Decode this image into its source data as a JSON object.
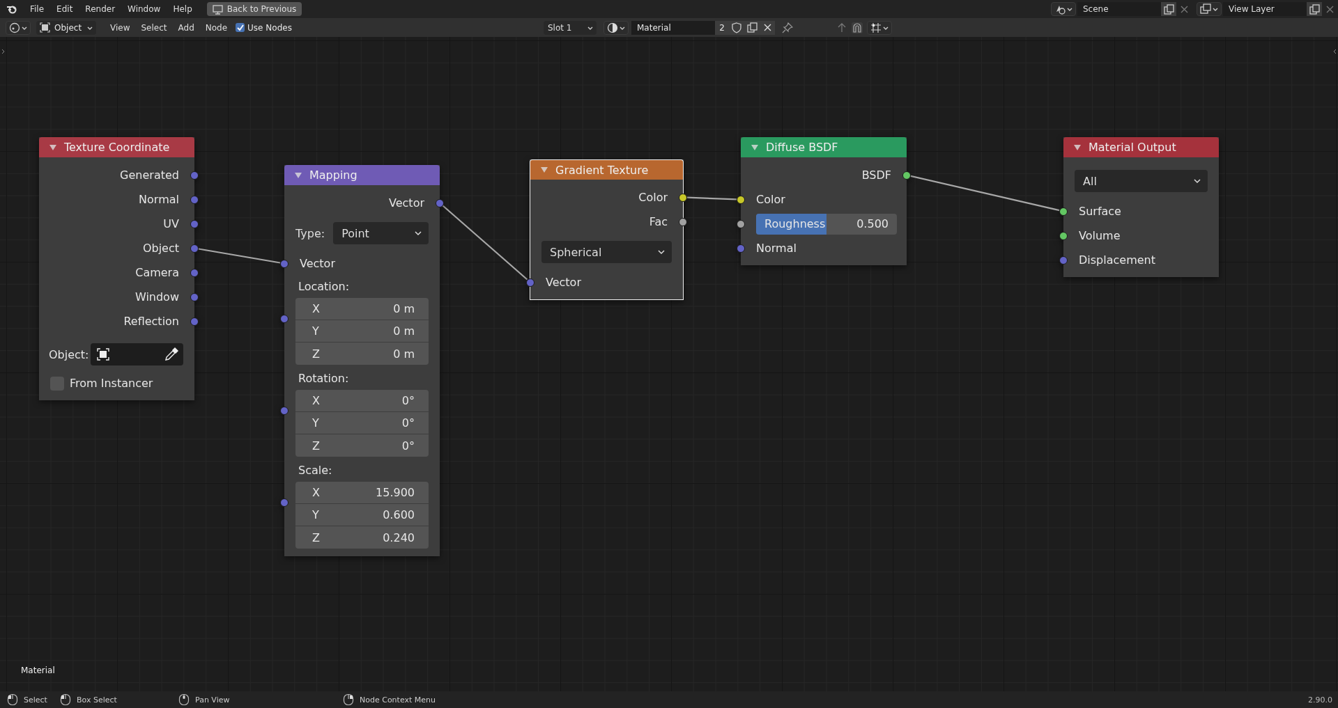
{
  "topbar": {
    "menus": [
      "File",
      "Edit",
      "Render",
      "Window",
      "Help"
    ],
    "back_button": "Back to Previous",
    "scene": {
      "value": "Scene"
    },
    "view_layer": {
      "value": "View Layer"
    }
  },
  "header": {
    "mode": "Object",
    "menus": [
      "View",
      "Select",
      "Add",
      "Node"
    ],
    "use_nodes": {
      "label": "Use Nodes",
      "checked": true
    },
    "slot": "Slot 1",
    "material": {
      "value": "Material",
      "users": "2"
    }
  },
  "nodes": [
    {
      "title": "Texture Coordinate",
      "color": "#a83a45",
      "selected": false,
      "items": [
        {
          "kind": "output",
          "label": "Generated",
          "color": "#6363c7"
        },
        {
          "kind": "output",
          "label": "Normal",
          "color": "#6363c7"
        },
        {
          "kind": "output",
          "label": "UV",
          "color": "#6363c7"
        },
        {
          "kind": "output",
          "label": "Object",
          "color": "#6363c7",
          "linked": true
        },
        {
          "kind": "output",
          "label": "Camera",
          "color": "#6363c7"
        },
        {
          "kind": "output",
          "label": "Window",
          "color": "#6363c7"
        },
        {
          "kind": "output",
          "label": "Reflection",
          "color": "#6363c7"
        },
        {
          "kind": "object",
          "label": "Object:"
        },
        {
          "kind": "checkbox",
          "label": "From Instancer",
          "checked": false
        }
      ]
    },
    {
      "title": "Mapping",
      "color": "#6f5bb5",
      "selected": false,
      "items": [
        {
          "kind": "output",
          "label": "Vector",
          "color": "#6363c7",
          "linked": true
        },
        {
          "kind": "menu",
          "label": "Type:",
          "value": "Point"
        },
        {
          "kind": "input",
          "label": "Vector",
          "color": "#6363c7",
          "linked": true
        },
        {
          "kind": "vector",
          "label": "Location:",
          "color": "#6363c7",
          "fields": [
            {
              "axis": "X",
              "value": "0 m"
            },
            {
              "axis": "Y",
              "value": "0 m"
            },
            {
              "axis": "Z",
              "value": "0 m"
            }
          ]
        },
        {
          "kind": "vector",
          "label": "Rotation:",
          "color": "#6363c7",
          "fields": [
            {
              "axis": "X",
              "value": "0°"
            },
            {
              "axis": "Y",
              "value": "0°"
            },
            {
              "axis": "Z",
              "value": "0°"
            }
          ]
        },
        {
          "kind": "vector",
          "label": "Scale:",
          "color": "#6363c7",
          "fields": [
            {
              "axis": "X",
              "value": "15.900"
            },
            {
              "axis": "Y",
              "value": "0.600"
            },
            {
              "axis": "Z",
              "value": "0.240"
            }
          ]
        }
      ]
    },
    {
      "title": "Gradient Texture",
      "color": "#b8672f",
      "selected": true,
      "items": [
        {
          "kind": "output",
          "label": "Color",
          "color": "#c7c729",
          "linked": true
        },
        {
          "kind": "output",
          "label": "Fac",
          "color": "#a1a1a1"
        },
        {
          "kind": "menu",
          "value": "Spherical"
        },
        {
          "kind": "input",
          "label": "Vector",
          "color": "#6363c7",
          "linked": true
        }
      ]
    },
    {
      "title": "Diffuse BSDF",
      "color": "#2a9a5f",
      "selected": false,
      "items": [
        {
          "kind": "output",
          "label": "BSDF",
          "color": "#63c763",
          "linked": true
        },
        {
          "kind": "input",
          "label": "Color",
          "color": "#c7c729",
          "linked": true
        },
        {
          "kind": "slider",
          "label": "Roughness",
          "value": "0.500",
          "level": 0.5,
          "color": "#a1a1a1"
        },
        {
          "kind": "input",
          "label": "Normal",
          "color": "#6363c7"
        }
      ]
    },
    {
      "title": "Material Output",
      "color": "#a5323c",
      "selected": false,
      "items": [
        {
          "kind": "menu",
          "value": "All"
        },
        {
          "kind": "input",
          "label": "Surface",
          "color": "#63c763",
          "linked": true
        },
        {
          "kind": "input",
          "label": "Volume",
          "color": "#63c763"
        },
        {
          "kind": "input",
          "label": "Displacement",
          "color": "#6363c7"
        }
      ]
    }
  ],
  "canvas_label": "Material",
  "status_bar": {
    "hints": [
      {
        "kind": "left",
        "label": "Select"
      },
      {
        "kind": "left",
        "label": "Box Select"
      },
      {
        "kind": "middle",
        "label": "Pan View"
      },
      {
        "kind": "right",
        "label": "Node Context Menu"
      }
    ],
    "version": "2.90.0"
  }
}
